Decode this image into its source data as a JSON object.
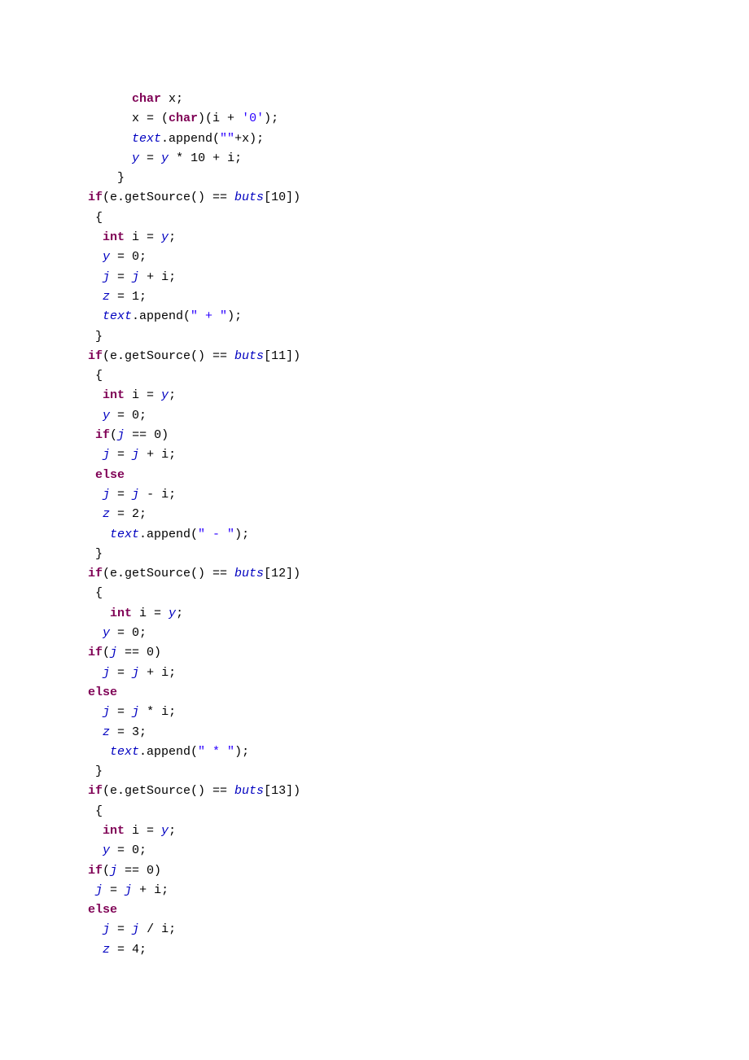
{
  "t": {
    "l01a": "      ",
    "l01b": "char",
    "l01c": " x;",
    "l02a": "      x = (",
    "l02b": "char",
    "l02c": ")(i + ",
    "l02d": "'0'",
    "l02e": ");",
    "l03a": "      ",
    "l03b": "text",
    "l03c": ".append(",
    "l03d": "\"\"",
    "l03e": "+x);",
    "l04a": "      ",
    "l04b": "y",
    "l04c": " = ",
    "l04d": "y",
    "l04e": " * 10 + i;",
    "l05a": "    }",
    "l06a": "if",
    "l06b": "(e.getSource() == ",
    "l06c": "buts",
    "l06d": "[10])",
    "l07a": " {",
    "l08a": "  ",
    "l08b": "int",
    "l08c": " i = ",
    "l08d": "y",
    "l08e": ";",
    "l09a": "  ",
    "l09b": "y",
    "l09c": " = 0;",
    "l10a": "  ",
    "l10b": "j",
    "l10c": " = ",
    "l10d": "j",
    "l10e": " + i;",
    "l11a": "  ",
    "l11b": "z",
    "l11c": " = 1;",
    "l12a": "  ",
    "l12b": "text",
    "l12c": ".append(",
    "l12d": "\" + \"",
    "l12e": ");",
    "l13a": " }",
    "l14a": "if",
    "l14b": "(e.getSource() == ",
    "l14c": "buts",
    "l14d": "[11])",
    "l15a": " {",
    "l16a": "  ",
    "l16b": "int",
    "l16c": " i = ",
    "l16d": "y",
    "l16e": ";",
    "l17a": "  ",
    "l17b": "y",
    "l17c": " = 0;",
    "l18a": " ",
    "l18b": "if",
    "l18c": "(",
    "l18d": "j",
    "l18e": " == 0)",
    "l19a": "  ",
    "l19b": "j",
    "l19c": " = ",
    "l19d": "j",
    "l19e": " + i;",
    "l20a": " ",
    "l20b": "else",
    "l21a": "  ",
    "l21b": "j",
    "l21c": " = ",
    "l21d": "j",
    "l21e": " - i;",
    "l22a": "  ",
    "l22b": "z",
    "l22c": " = 2;",
    "l23a": "   ",
    "l23b": "text",
    "l23c": ".append(",
    "l23d": "\" - \"",
    "l23e": ");",
    "l24a": " }",
    "l25a": "if",
    "l25b": "(e.getSource() == ",
    "l25c": "buts",
    "l25d": "[12])",
    "l26a": " {",
    "l27a": "   ",
    "l27b": "int",
    "l27c": " i = ",
    "l27d": "y",
    "l27e": ";",
    "l28a": "  ",
    "l28b": "y",
    "l28c": " = 0;",
    "l29a": "if",
    "l29b": "(",
    "l29c": "j",
    "l29d": " == 0)",
    "l30a": "  ",
    "l30b": "j",
    "l30c": " = ",
    "l30d": "j",
    "l30e": " + i;",
    "l31a": "else",
    "l32a": "  ",
    "l32b": "j",
    "l32c": " = ",
    "l32d": "j",
    "l32e": " * i;",
    "l33a": "  ",
    "l33b": "z",
    "l33c": " = 3;",
    "l34a": "   ",
    "l34b": "text",
    "l34c": ".append(",
    "l34d": "\" * \"",
    "l34e": ");",
    "l35a": " }",
    "l36a": "if",
    "l36b": "(e.getSource() == ",
    "l36c": "buts",
    "l36d": "[13])",
    "l37a": " {",
    "l38a": "  ",
    "l38b": "int",
    "l38c": " i = ",
    "l38d": "y",
    "l38e": ";",
    "l39a": "  ",
    "l39b": "y",
    "l39c": " = 0;",
    "l40a": "if",
    "l40b": "(",
    "l40c": "j",
    "l40d": " == 0)",
    "l41a": " ",
    "l41b": "j",
    "l41c": " = ",
    "l41d": "j",
    "l41e": " + i;",
    "l42a": "else",
    "l43a": "  ",
    "l43b": "j",
    "l43c": " = ",
    "l43d": "j",
    "l43e": " / i;",
    "l44a": "  ",
    "l44b": "z",
    "l44c": " = 4;"
  }
}
